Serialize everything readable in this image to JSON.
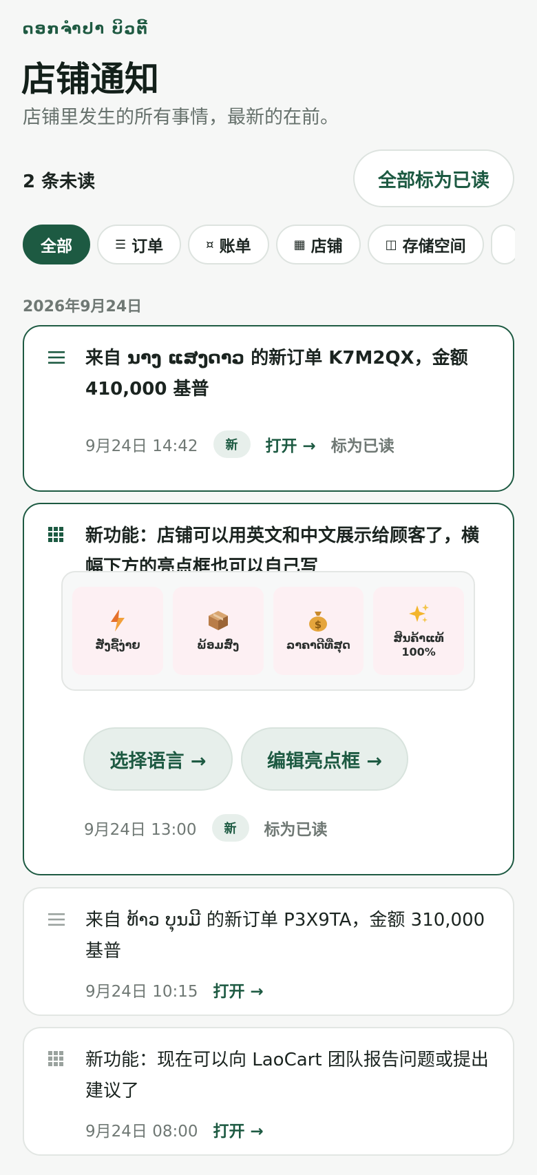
{
  "header": {
    "shop_name": "ດອກຈຳປາ ບິວຕີ້",
    "title": "店铺通知",
    "subtitle": "店铺里发生的所有事情，最新的在前。"
  },
  "toolbar": {
    "unread_count": "2 条未读",
    "mark_all_label": "全部标为已读"
  },
  "filters": [
    {
      "label": "全部",
      "icon": "",
      "active": true
    },
    {
      "label": "订单",
      "icon": "☰"
    },
    {
      "label": "账单",
      "icon": "¤"
    },
    {
      "label": "店铺",
      "icon": "▦"
    },
    {
      "label": "存储空间",
      "icon": "◫"
    }
  ],
  "date_group": "2026年9月24日",
  "notifications": [
    {
      "icon": "list-icon",
      "title": "来自 ນາງ ແສງດາວ 的新订单 K7M2QX，金额 410,000 基普",
      "time": "9月24日 14:42",
      "badge": "新",
      "open_label": "打开 →",
      "mark_read_label": "标为已读"
    },
    {
      "icon": "grid-icon",
      "title": "新功能：店铺可以用英文和中文展示给顾客了，横幅下方的亮点框也可以自己写",
      "highlights": [
        {
          "icon": "lightning-icon",
          "label": "ສັ່ງຊື້ງ່າຍ"
        },
        {
          "icon": "package-icon",
          "label": "ພ້ອມສົ່ງ"
        },
        {
          "icon": "money-bag-icon",
          "label": "ລາຄາດີທີ່ສຸດ"
        },
        {
          "icon": "sparkles-icon",
          "label": "ສິນຄ້າແທ້\n100%"
        }
      ],
      "action_language": "选择语言 →",
      "action_highlights": "编辑亮点框 →",
      "time": "9月24日 13:00",
      "badge": "新",
      "mark_read_label": "标为已读"
    },
    {
      "icon": "list-icon",
      "title": "来自 ທ້າວ ບຸນມີ 的新订单 P3X9TA，金额 310,000 基普",
      "time": "9月24日 10:15",
      "open_label": "打开 →"
    },
    {
      "icon": "grid-icon",
      "title": "新功能：现在可以向 LaoCart 团队报告问题或提出建议了",
      "time": "9月24日 08:00",
      "open_label": "打开 →"
    }
  ],
  "colors": {
    "accent": "#1d5a42",
    "badge_bg": "#e7efeb",
    "tile_bg": "#fdf0f3",
    "page_bg": "#f6f7f6"
  }
}
